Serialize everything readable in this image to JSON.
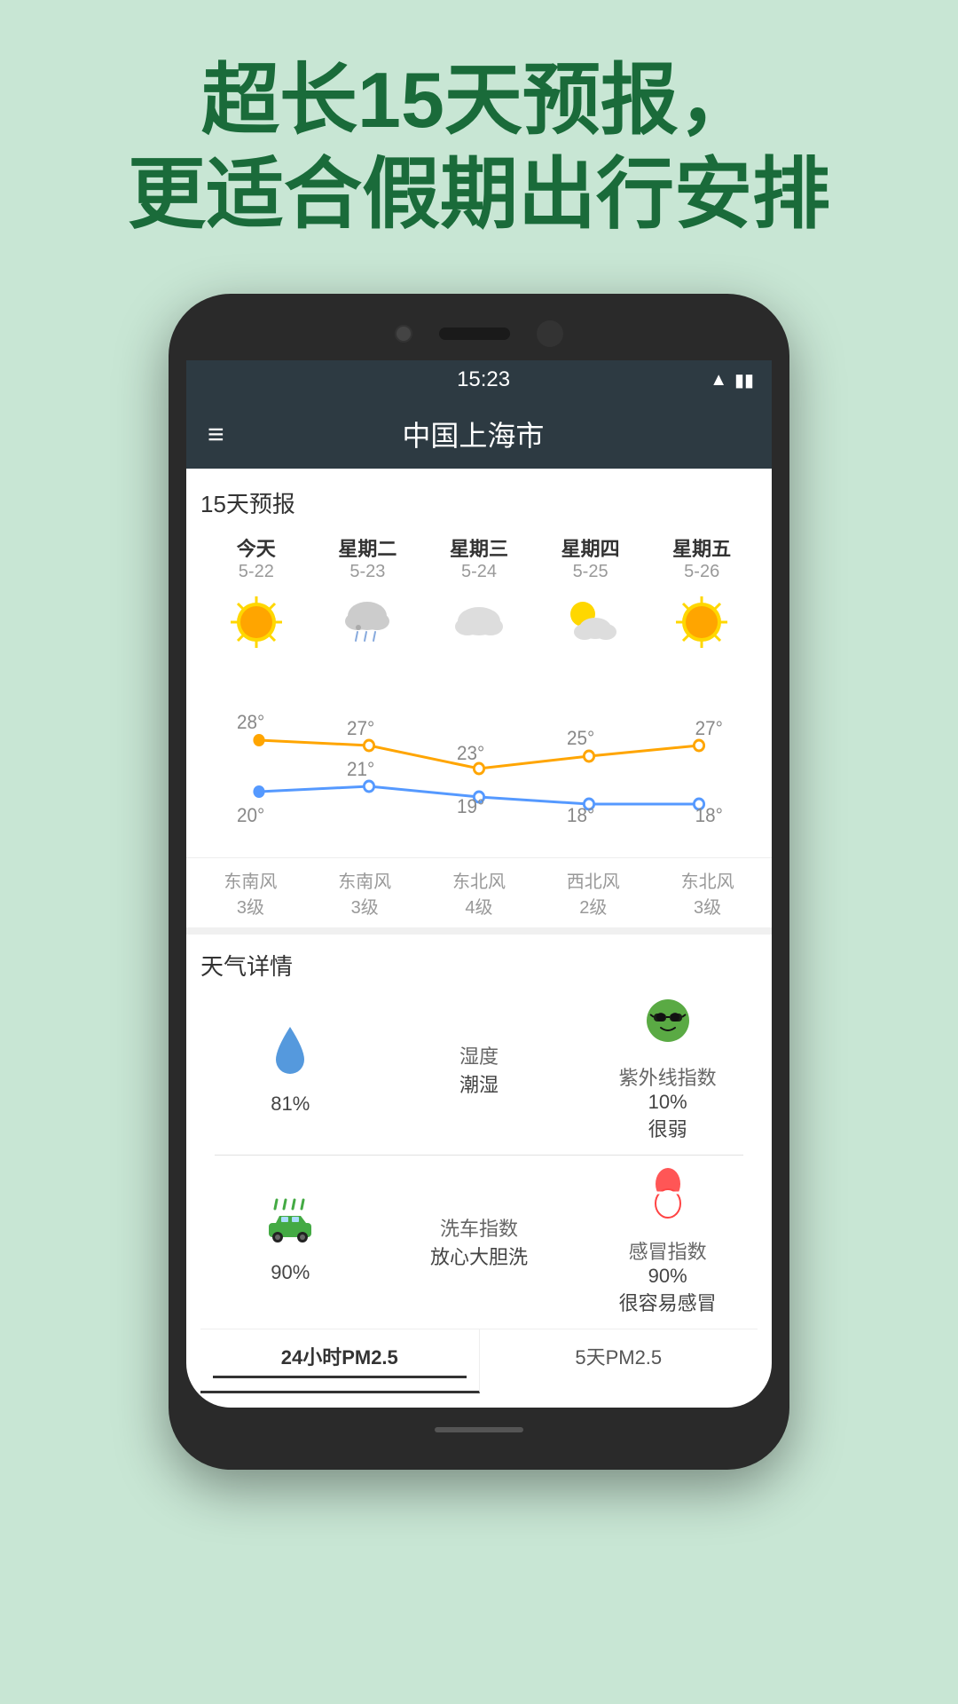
{
  "header": {
    "line1": "超长15天预报，",
    "line2": "更适合假期出行安排"
  },
  "statusBar": {
    "time": "15:23",
    "wifi": "WiFi",
    "battery": "🔋"
  },
  "appBar": {
    "menu": "≡",
    "cityName": "中国上海市"
  },
  "forecast": {
    "sectionTitle": "15天预报",
    "days": [
      {
        "name": "今天",
        "date": "5-22",
        "icon": "sun",
        "highTemp": 28,
        "lowTemp": 20,
        "windDir": "东南风",
        "windLevel": "3级"
      },
      {
        "name": "星期二",
        "date": "5-23",
        "icon": "cloud-rain",
        "highTemp": 27,
        "lowTemp": 21,
        "windDir": "东南风",
        "windLevel": "3级"
      },
      {
        "name": "星期三",
        "date": "5-24",
        "icon": "cloud",
        "highTemp": 23,
        "lowTemp": 19,
        "windDir": "东北风",
        "windLevel": "4级"
      },
      {
        "name": "星期四",
        "date": "5-25",
        "icon": "sun-cloud",
        "highTemp": 25,
        "lowTemp": 18,
        "windDir": "西北风",
        "windLevel": "2级"
      },
      {
        "name": "星期五",
        "date": "5-26",
        "icon": "sun",
        "highTemp": 27,
        "lowTemp": 18,
        "windDir": "东北风",
        "windLevel": "3级"
      }
    ]
  },
  "details": {
    "sectionTitle": "天气详情",
    "items": [
      {
        "icon": "💧",
        "value": "81%",
        "label": "",
        "type": "humidity"
      },
      {
        "label": "湿度",
        "sublabel": "潮湿",
        "type": "label"
      },
      {
        "icon": "😎",
        "value": "10%",
        "label": "紫外线指数",
        "sublabel": "很弱",
        "type": "uv"
      },
      {
        "icon": "🚗",
        "value": "90%",
        "label": "",
        "type": "car-wash"
      },
      {
        "label": "洗车指数",
        "sublabel": "放心大胆洗",
        "type": "label2"
      },
      {
        "icon": "💊",
        "value": "90%",
        "label": "感冒指数",
        "sublabel": "很容易感冒",
        "type": "cold"
      }
    ]
  },
  "bottomTabs": [
    {
      "label": "24小时PM2.5",
      "active": true
    },
    {
      "label": "5天PM2.5",
      "active": false
    }
  ]
}
